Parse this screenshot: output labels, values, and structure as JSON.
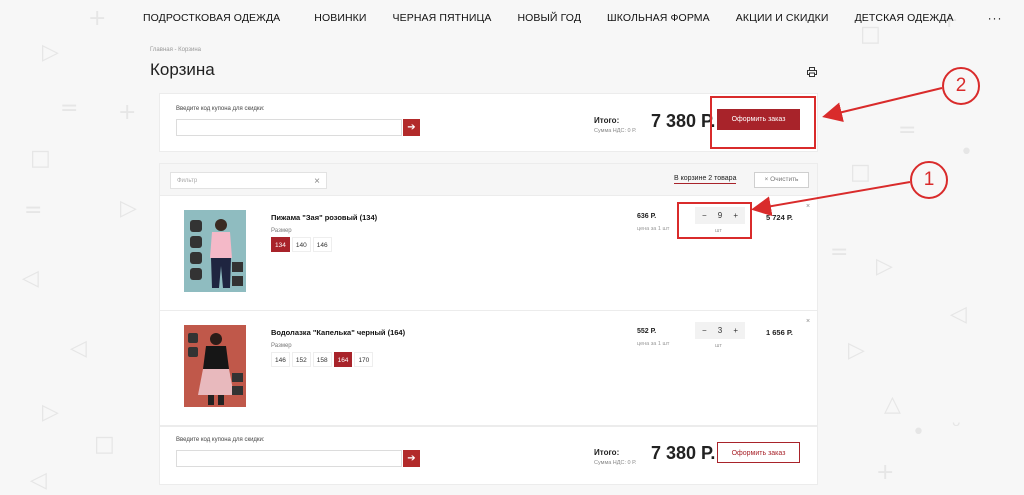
{
  "nav": {
    "items": [
      "ПОДРОСТКОВАЯ ОДЕЖДА",
      "НОВИНКИ",
      "ЧЕРНАЯ ПЯТНИЦА",
      "НОВЫЙ ГОД",
      "ШКОЛЬНАЯ ФОРМА",
      "АКЦИИ И СКИДКИ",
      "ДЕТСКАЯ ОДЕЖДА"
    ],
    "more": "···"
  },
  "breadcrumb": "Главная - Корзина",
  "page_title": "Корзина",
  "coupon": {
    "label": "Введите код купона для скидки:",
    "placeholder": ""
  },
  "summary": {
    "total_label": "Итого:",
    "vat_label": "Сумма НДС: 0 Р.",
    "total_value": "7 380 Р.",
    "checkout_label": "Оформить заказ"
  },
  "filter": {
    "placeholder": "Фильтр",
    "clear_icon": "×",
    "cart_count": "В корзине 2 товара",
    "clear_button": "× Очистить"
  },
  "items": [
    {
      "name": "Пижама \"Зая\" розовый (134)",
      "size_label": "Размер",
      "sizes": [
        "134",
        "140",
        "146"
      ],
      "active_size": "134",
      "unit_price": "636 Р.",
      "per_unit": "цена за 1 шт",
      "qty": "9",
      "minus": "−",
      "plus": "+",
      "qty_unit": "шт",
      "line_total": "5 724 Р.",
      "remove": "×"
    },
    {
      "name": "Водолазка \"Капелька\" черный (164)",
      "size_label": "Размер",
      "sizes": [
        "146",
        "152",
        "158",
        "164",
        "170"
      ],
      "active_size": "164",
      "unit_price": "552 Р.",
      "per_unit": "цена за 1 шт",
      "qty": "3",
      "minus": "−",
      "plus": "+",
      "qty_unit": "шт",
      "line_total": "1 656 Р.",
      "remove": "×"
    }
  ],
  "annotations": {
    "one": "1",
    "two": "2",
    "color": "#d92b2b"
  },
  "colors": {
    "accent": "#a8232a",
    "background": "#f7f7f7"
  },
  "icons": {
    "print": "print-icon",
    "arrow": "arrow-right-icon"
  }
}
